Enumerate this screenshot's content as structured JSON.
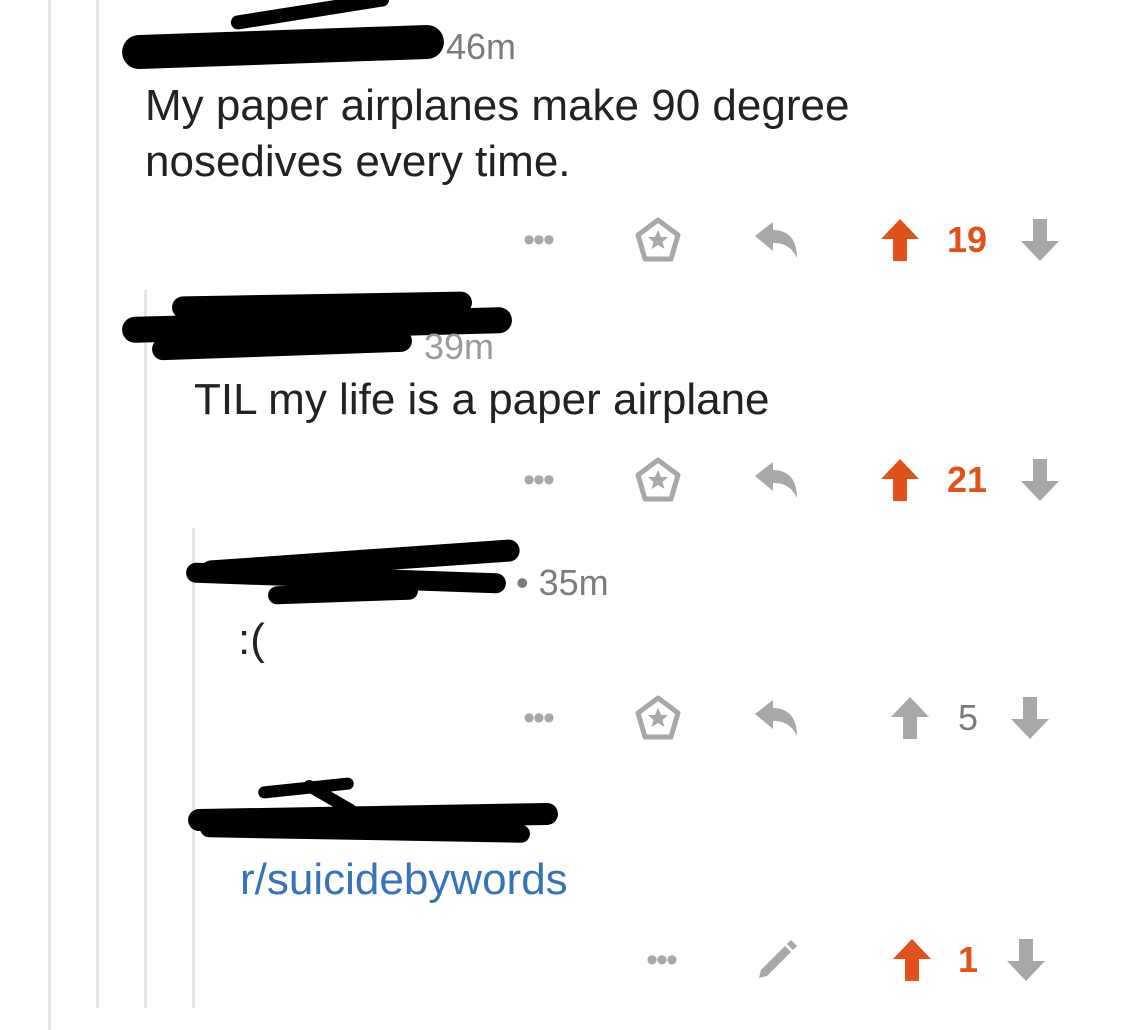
{
  "comments": [
    {
      "timestamp": "46m",
      "body": "My paper airplanes make 90 degree nosedives every time.",
      "score": "19",
      "upvoted": true
    },
    {
      "timestamp": "39m",
      "body": "TIL my life is a paper airplane",
      "score": "21",
      "upvoted": true
    },
    {
      "timestamp": "• 35m",
      "body": ":(",
      "score": "5",
      "upvoted": false
    },
    {
      "timestamp": "",
      "body": "r/suicidebywords",
      "score": "1",
      "upvoted": true,
      "own_comment": true
    }
  ],
  "icons": {
    "more": "more-dots-icon",
    "save": "star-save-icon",
    "reply": "reply-arrow-icon",
    "upvote": "upvote-arrow-icon",
    "downvote": "downvote-arrow-icon",
    "edit": "pencil-edit-icon"
  },
  "colors": {
    "upvote_active": "#e0521b",
    "icon_gray": "#a8a8a8",
    "link": "#3673b8",
    "thread_line": "#e6e6e6"
  }
}
